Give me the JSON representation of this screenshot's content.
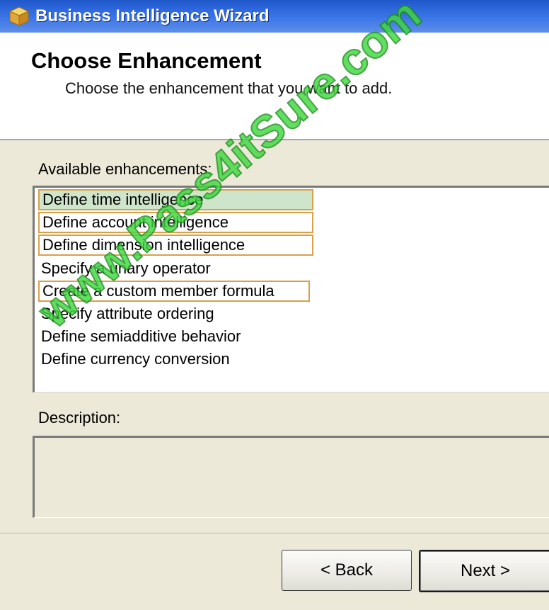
{
  "window": {
    "title": "Business Intelligence Wizard",
    "icon": "wizard-cube-icon"
  },
  "header": {
    "title": "Choose Enhancement",
    "subtitle": "Choose the enhancement that you want to add."
  },
  "enhancements": {
    "label": "Available enhancements:",
    "items": [
      "Define time intelligence",
      "Define account intelligence",
      "Define dimension intelligence",
      "Specify a unary operator",
      "Create a custom member formula",
      "Specify attribute ordering",
      "Define semiadditive behavior",
      "Define currency conversion"
    ],
    "selected": "Define time intelligence"
  },
  "description": {
    "label": "Description:",
    "text": ""
  },
  "buttons": {
    "back": "< Back",
    "next": "Next >"
  },
  "watermark": "www.Pass4itSure.com",
  "colors": {
    "titlebar": "#2a63d8",
    "selected_item": "#cfe5cb",
    "highlight_border": "#d9a04a",
    "watermark": "#3fd83f"
  }
}
